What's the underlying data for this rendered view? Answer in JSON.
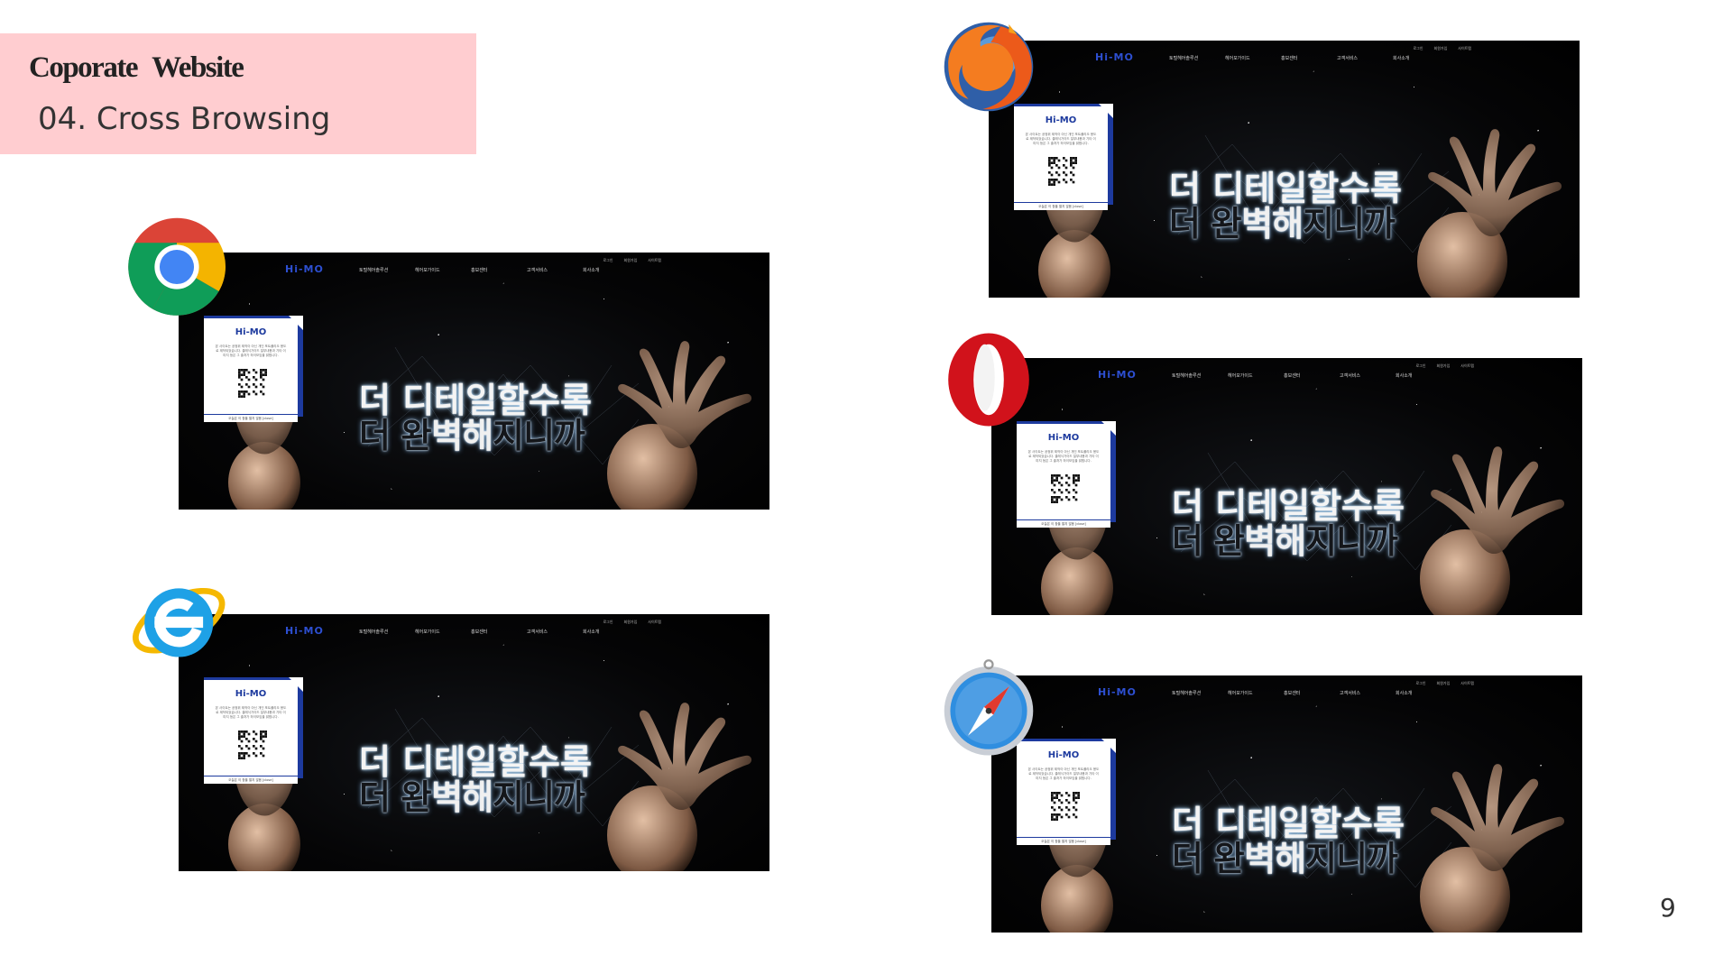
{
  "slide": {
    "title": "Coporate Website",
    "subtitle": "04. Cross Browsing",
    "page_number": "9"
  },
  "browsers": [
    {
      "name": "Chrome",
      "icon": "chrome-logo-icon"
    },
    {
      "name": "Internet Explorer",
      "icon": "internet-explorer-logo-icon"
    },
    {
      "name": "Firefox",
      "icon": "firefox-logo-icon"
    },
    {
      "name": "Opera",
      "icon": "opera-logo-icon"
    },
    {
      "name": "Safari",
      "icon": "safari-logo-icon"
    }
  ],
  "site": {
    "brand": "Hi-MO",
    "top_links": [
      "로그인",
      "회원가입",
      "사이트맵"
    ],
    "nav": [
      "토털헤어솔루션",
      "헤어모가이드",
      "홍보센터",
      "고객서비스",
      "회사소개"
    ],
    "headline_line1": "더 디테일할수록",
    "headline_line2_parts": [
      "더 ",
      "완",
      "벽",
      "해",
      "지",
      "니까"
    ],
    "popup": {
      "brand": "Hi-MO",
      "text": "본 사이트는 공정위 제작이 아닌 개인 포트폴리오 용도로 제작되었습니다. 클래식가이드 일부내용과 기타 이미지 등은 그 출처가 하이모임을 밝힙니다.",
      "footer": "오늘은 이 창을 열지 않음 [close]"
    }
  },
  "colors": {
    "title_bg": "#ffcdd0",
    "brand_blue": "#2d4fd1",
    "popup_border": "#1d3a9e"
  }
}
